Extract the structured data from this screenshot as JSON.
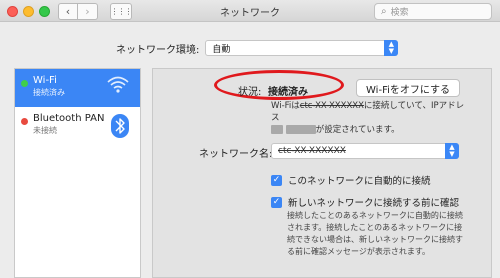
{
  "window": {
    "title": "ネットワーク",
    "search_placeholder": "検索",
    "nav_back": "‹",
    "nav_forward": "›",
    "grid_icon": "⋮⋮⋮"
  },
  "location": {
    "label": "ネットワーク環境:",
    "value": "自動"
  },
  "sidebar": {
    "items": [
      {
        "name": "Wi-Fi",
        "status": "接続済み",
        "status_color": "#3fcf4b",
        "icon": "wifi-icon",
        "selected": true
      },
      {
        "name": "Bluetooth PAN",
        "status": "未接続",
        "status_color": "#e84a3f",
        "icon": "bluetooth-icon",
        "selected": false
      }
    ]
  },
  "main": {
    "status_label": "状況:",
    "status_value": "接続済み",
    "wifi_off_button": "Wi-Fiをオフにする",
    "description_line1_start": "Wi-Fiは",
    "description_line1_net": "ctc-XX-XXXXXX",
    "description_line1_end": "に接続していて、IPアドレス",
    "description_line2": "が設定されています。",
    "network_name_label": "ネットワーク名:",
    "network_name_value": "ctc-XX-XXXXXX",
    "checkbox_auto_join": "このネットワークに自動的に接続",
    "checkbox_ask_join": "新しいネットワークに接続する前に確認",
    "note": "接続したことのあるネットワークに自動的に接続されます。接続したことのあるネットワークに接続できない場合は、新しいネットワークに接続する前に確認メッセージが表示されます。"
  },
  "colors": {
    "accent": "#3b86f5",
    "highlight_ellipse": "#e0191d"
  }
}
